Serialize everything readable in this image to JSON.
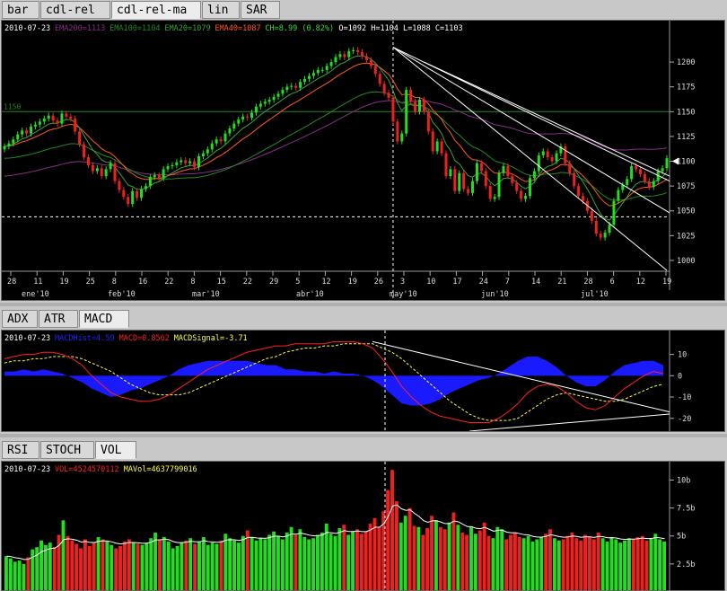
{
  "tabs_top": [
    "bar",
    "cdl-rel",
    "cdl-rel-ma",
    "lin",
    "SAR"
  ],
  "tabs_top_active": 2,
  "tabs_mid": [
    "ADX",
    "ATR",
    "MACD"
  ],
  "tabs_mid_active": 2,
  "tabs_bot": [
    "RSI",
    "STOCH",
    "VOL"
  ],
  "tabs_bot_active": 2,
  "price_legend": [
    {
      "text": "2010-07-23",
      "color": "#ffffff"
    },
    {
      "text": "EMA200=1113",
      "color": "#8a2d8a"
    },
    {
      "text": "EMA100=1104",
      "color": "#1f8a1f"
    },
    {
      "text": "EMA20=1079",
      "color": "#3aa33a"
    },
    {
      "text": "EMA40=1087",
      "color": "#ff5a1a"
    },
    {
      "text": "CH=8.99 (0.82%)",
      "color": "#3adc3a"
    },
    {
      "text": "O=1092 H=1104 L=1088 C=1103",
      "color": "#ffffff"
    }
  ],
  "macd_legend": [
    {
      "text": "2010-07-23",
      "color": "#ffffff"
    },
    {
      "text": "MACDHist=4.59",
      "color": "#2020ff"
    },
    {
      "text": "MACD=0.8562",
      "color": "#ff2020"
    },
    {
      "text": "MACDSignal=-3.71",
      "color": "#ffff40"
    }
  ],
  "vol_legend": [
    {
      "text": "2010-07-23",
      "color": "#ffffff"
    },
    {
      "text": "VOL=4524570112",
      "color": "#ff2020"
    },
    {
      "text": "MAVol=4637799016",
      "color": "#ffff40"
    }
  ],
  "level_label": "1150",
  "price_ticks": [
    "1200",
    "1175",
    "1150",
    "1125",
    "1100",
    "1075",
    "1050",
    "1025",
    "1000"
  ],
  "macd_ticks": [
    "10",
    "0",
    "-10",
    "-20"
  ],
  "vol_ticks": [
    "10b",
    "7.5b",
    "5b",
    "2.5b"
  ],
  "x_day_labels": [
    "28",
    "11",
    "19",
    "25",
    "8",
    "16",
    "22",
    "8",
    "15",
    "22",
    "29",
    "5",
    "12",
    "19",
    "26",
    "3",
    "10",
    "17",
    "24",
    "7",
    "14",
    "21",
    "28",
    "6",
    "12",
    "19"
  ],
  "x_month_labels": [
    "ene'10",
    "feb'10",
    "mar'10",
    "abr'10",
    "may'10",
    "jun'10",
    "jul'10"
  ],
  "colors": {
    "up": "#22dd22",
    "down": "#ee2020",
    "ema20": "#3aa33a",
    "ema40": "#ff5a1a",
    "ema100": "#1f8a1f",
    "ema200": "#8a2d8a",
    "macd": "#ff2020",
    "signal": "#ffff40",
    "hist": "#1a1aff",
    "mavol": "#ffffff",
    "level": "#1f8a1f"
  },
  "chart_data": [
    {
      "type": "candlestick",
      "title": "",
      "xlabel": "",
      "ylabel": "",
      "ylim": [
        990,
        1220
      ],
      "last_date": "2010-07-23",
      "ohlc_last": {
        "open": 1092,
        "high": 1104,
        "low": 1088,
        "close": 1103
      },
      "ema": {
        "ema20": 1079,
        "ema40": 1087,
        "ema100": 1104,
        "ema200": 1113
      },
      "closes": [
        1115,
        1118,
        1122,
        1127,
        1131,
        1128,
        1135,
        1137,
        1140,
        1143,
        1146,
        1141,
        1138,
        1148,
        1145,
        1143,
        1130,
        1117,
        1104,
        1096,
        1090,
        1093,
        1085,
        1092,
        1098,
        1080,
        1071,
        1064,
        1057,
        1070,
        1063,
        1072,
        1075,
        1084,
        1086,
        1083,
        1092,
        1095,
        1096,
        1099,
        1101,
        1098,
        1100,
        1094,
        1105,
        1108,
        1112,
        1118,
        1122,
        1120,
        1128,
        1133,
        1138,
        1142,
        1145,
        1144,
        1149,
        1155,
        1158,
        1160,
        1162,
        1165,
        1168,
        1172,
        1175,
        1176,
        1174,
        1180,
        1183,
        1186,
        1189,
        1192,
        1192,
        1196,
        1200,
        1205,
        1208,
        1205,
        1211,
        1212,
        1210,
        1206,
        1202,
        1196,
        1188,
        1178,
        1169,
        1164,
        1140,
        1120,
        1128,
        1172,
        1160,
        1150,
        1162,
        1150,
        1130,
        1110,
        1120,
        1108,
        1085,
        1092,
        1070,
        1088,
        1072,
        1068,
        1080,
        1098,
        1090,
        1075,
        1062,
        1064,
        1088,
        1095,
        1085,
        1078,
        1070,
        1062,
        1065,
        1083,
        1090,
        1106,
        1110,
        1104,
        1100,
        1108,
        1115,
        1098,
        1088,
        1075,
        1065,
        1060,
        1050,
        1040,
        1027,
        1023,
        1028,
        1036,
        1060,
        1071,
        1076,
        1082,
        1095,
        1092,
        1087,
        1080,
        1074,
        1080,
        1090,
        1093,
        1103
      ],
      "volume_b": [
        3.2,
        3.0,
        2.7,
        2.8,
        2.5,
        3.1,
        3.8,
        4.0,
        4.6,
        4.2,
        4.4,
        4.0,
        5.1,
        6.4,
        5.0,
        4.6,
        4.3,
        3.9,
        4.7,
        4.1,
        4.4,
        4.9,
        4.7,
        4.5,
        4.2,
        3.9,
        4.1,
        4.5,
        4.7,
        4.4,
        4.3,
        4.2,
        4.4,
        4.8,
        5.3,
        4.7,
        4.9,
        4.5,
        3.9,
        4.1,
        4.4,
        4.6,
        4.8,
        4.3,
        4.5,
        4.9,
        4.2,
        4.4,
        4.3,
        4.6,
        5.2,
        4.8,
        4.6,
        4.4,
        5.0,
        5.5,
        4.9,
        4.6,
        4.8,
        4.7,
        5.1,
        5.4,
        5.0,
        4.7,
        5.3,
        5.8,
        5.1,
        5.6,
        4.9,
        4.7,
        4.8,
        5.1,
        5.3,
        6.1,
        5.2,
        5.0,
        5.7,
        6.0,
        5.1,
        5.4,
        5.6,
        5.2,
        5.4,
        6.1,
        6.6,
        5.8,
        7.2,
        9.1,
        10.9,
        8.1,
        6.2,
        6.8,
        7.5,
        5.9,
        5.8,
        5.1,
        5.7,
        6.8,
        6.4,
        5.8,
        5.6,
        6.2,
        7.1,
        6.0,
        5.3,
        5.1,
        5.8,
        5.2,
        5.5,
        6.2,
        5.0,
        4.8,
        5.8,
        5.6,
        4.7,
        5.1,
        5.3,
        4.9,
        4.8,
        5.0,
        4.5,
        4.7,
        4.9,
        5.2,
        5.6,
        4.8,
        4.6,
        4.7,
        5.0,
        5.3,
        4.8,
        4.6,
        5.1,
        4.9,
        4.7,
        5.3,
        4.8,
        4.5,
        4.9,
        4.7,
        4.4,
        4.6,
        4.8,
        4.7,
        4.9,
        5.0,
        4.6,
        4.8,
        5.2,
        4.7,
        4.5
      ]
    },
    {
      "type": "line",
      "title": "",
      "ylim": [
        -26,
        17
      ],
      "series": [
        {
          "name": "MACD",
          "values": [
            8,
            9,
            10,
            10,
            11,
            11,
            10,
            8,
            5,
            0,
            -4,
            -8,
            -10,
            -11,
            -12,
            -12,
            -11,
            -9,
            -6,
            -3,
            0,
            3,
            5,
            7,
            9,
            11,
            12,
            13,
            14,
            14,
            15,
            15,
            15,
            15,
            16,
            16,
            16,
            15,
            13,
            8,
            2,
            -5,
            -10,
            -14,
            -17,
            -19,
            -20,
            -21,
            -22,
            -22,
            -22,
            -20,
            -17,
            -13,
            -8,
            -5,
            -4,
            -5,
            -8,
            -12,
            -15,
            -16,
            -14,
            -10,
            -6,
            -3,
            0,
            2,
            1
          ]
        },
        {
          "name": "MACDSignal",
          "values": [
            6,
            7,
            7,
            8,
            8,
            9,
            9,
            9,
            8,
            6,
            4,
            2,
            -1,
            -4,
            -6,
            -8,
            -9,
            -9,
            -9,
            -8,
            -6,
            -4,
            -2,
            0,
            2,
            4,
            6,
            8,
            9,
            11,
            12,
            13,
            13,
            14,
            14,
            15,
            15,
            15,
            15,
            13,
            11,
            8,
            4,
            0,
            -4,
            -8,
            -12,
            -15,
            -18,
            -20,
            -21,
            -21,
            -21,
            -20,
            -17,
            -14,
            -11,
            -9,
            -8,
            -9,
            -10,
            -11,
            -12,
            -12,
            -11,
            -9,
            -7,
            -5,
            -4
          ]
        }
      ]
    },
    {
      "type": "bar",
      "title": "",
      "ylim": [
        0,
        11
      ],
      "series": [
        {
          "name": "MAVol",
          "values": [
            3.2,
            4.4,
            4.6,
            4.5,
            4.4,
            4.6,
            4.7,
            4.8,
            4.9,
            5.1,
            5.2,
            5.6,
            6.3,
            6.8,
            6.0,
            5.7,
            5.5,
            5.2,
            5.1,
            4.9,
            4.9,
            4.9,
            4.8,
            4.8,
            4.7,
            4.7,
            4.6
          ]
        }
      ]
    }
  ]
}
